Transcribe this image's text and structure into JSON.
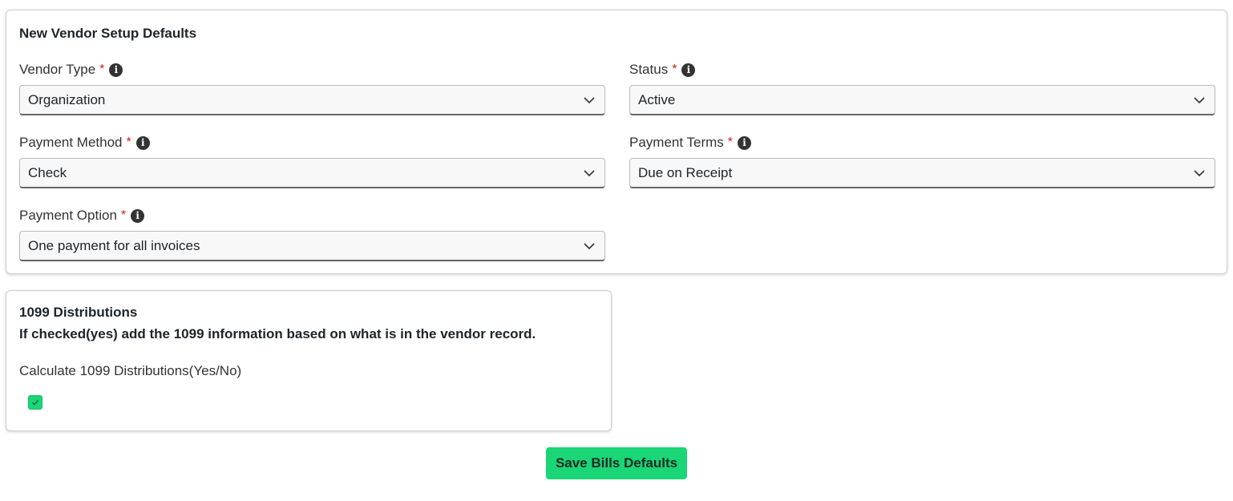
{
  "vendor_setup": {
    "title": "New Vendor Setup Defaults",
    "fields": [
      {
        "label": "Vendor Type",
        "required_mark": "*",
        "info_icon": "info-circle-icon",
        "value": "Organization"
      },
      {
        "label": "Status",
        "required_mark": "*",
        "info_icon": "info-circle-icon",
        "value": "Active"
      },
      {
        "label": "Payment Method",
        "required_mark": "*",
        "info_icon": "info-circle-icon",
        "value": "Check"
      },
      {
        "label": "Payment Terms",
        "required_mark": "*",
        "info_icon": "info-circle-icon",
        "value": "Due on Receipt"
      },
      {
        "label": "Payment Option",
        "required_mark": "*",
        "info_icon": "info-circle-icon",
        "value": "One payment for all invoices"
      }
    ]
  },
  "distributions_1099": {
    "title": "1099 Distributions",
    "description": "If checked(yes) add the 1099 information based on what is in the vendor record.",
    "checkbox_label": "Calculate 1099 Distributions(Yes/No)",
    "checked": true
  },
  "actions": {
    "save_label": "Save Bills Defaults"
  },
  "colors": {
    "accent": "#1ad676",
    "required": "#d11a1a",
    "info_icon": "#333333"
  }
}
